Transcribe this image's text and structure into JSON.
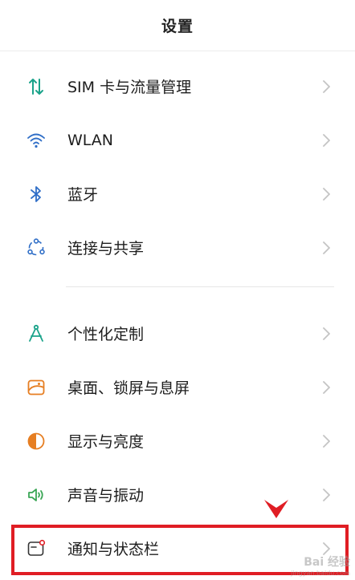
{
  "header": {
    "title": "设置"
  },
  "group1": [
    {
      "label": "SIM 卡与流量管理",
      "icon": "sim-data-icon"
    },
    {
      "label": "WLAN",
      "icon": "wifi-icon"
    },
    {
      "label": "蓝牙",
      "icon": "bluetooth-icon"
    },
    {
      "label": "连接与共享",
      "icon": "connection-share-icon"
    }
  ],
  "group2": [
    {
      "label": "个性化定制",
      "icon": "personalize-icon"
    },
    {
      "label": "桌面、锁屏与息屏",
      "icon": "wallpaper-icon"
    },
    {
      "label": "显示与亮度",
      "icon": "display-brightness-icon"
    },
    {
      "label": "声音与振动",
      "icon": "sound-icon"
    },
    {
      "label": "通知与状态栏",
      "icon": "notification-icon"
    }
  ],
  "colors": {
    "accent_teal": "#1aa38a",
    "highlight_red": "#e01d24",
    "chevron": "#c4c4c4",
    "divider": "#e6e6e6"
  },
  "watermark": {
    "logo": "Bai 经验",
    "url": "jingyan.baidu.com"
  }
}
